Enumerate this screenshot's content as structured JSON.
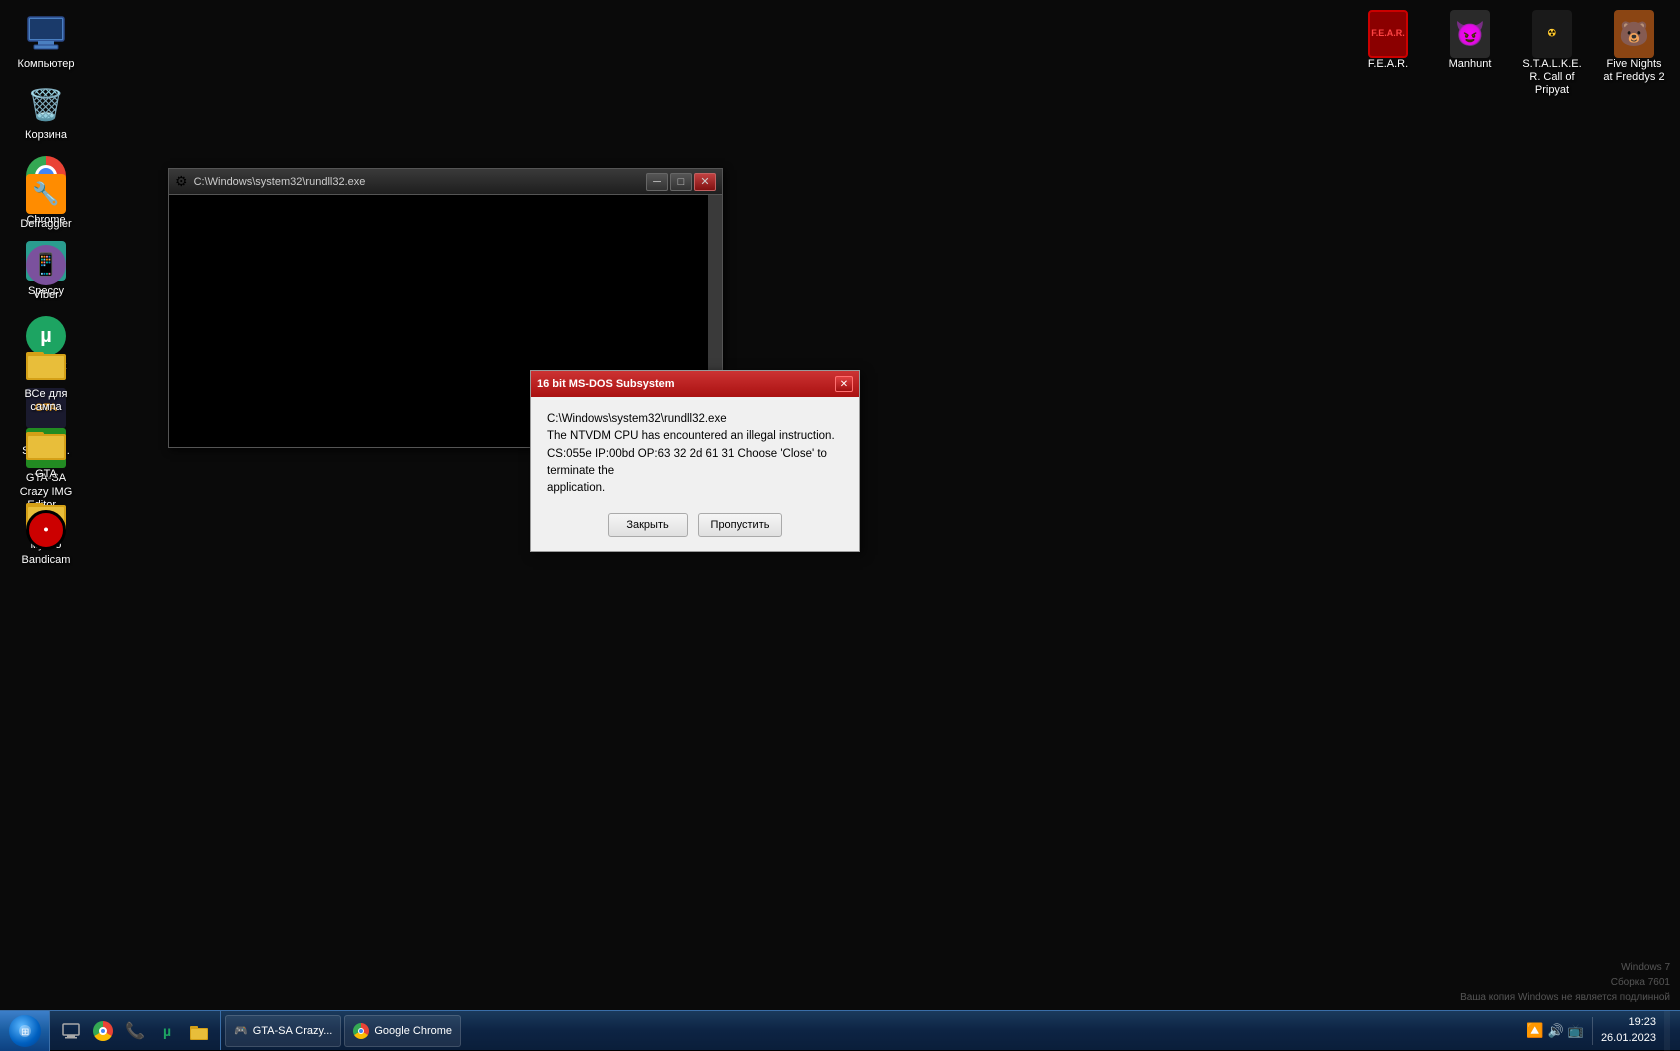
{
  "desktop": {
    "background": "#060606"
  },
  "desktop_icons_left": [
    {
      "id": "computer",
      "label": "Компьютер",
      "icon": "computer"
    },
    {
      "id": "recycle",
      "label": "Корзина",
      "icon": "recycle"
    },
    {
      "id": "chrome",
      "label": "Google Chrome",
      "icon": "chrome"
    },
    {
      "id": "speccy",
      "label": "Speccy",
      "icon": "speccy"
    },
    {
      "id": "defraggler",
      "label": "Defraggler",
      "icon": "defraggler"
    },
    {
      "id": "viber",
      "label": "Viber",
      "icon": "viber"
    },
    {
      "id": "utorrent",
      "label": "µTorrent",
      "icon": "utorrent"
    },
    {
      "id": "gta-sa-cra",
      "label": "GTA-SA_Cra...",
      "icon": "gta"
    },
    {
      "id": "vsesampa",
      "label": "ВСе для сампа",
      "icon": "folder"
    },
    {
      "id": "imgedad",
      "label": "GTA-SA Crazy IMG Editor...",
      "icon": "imged"
    },
    {
      "id": "gta",
      "label": "GTA",
      "icon": "folder"
    },
    {
      "id": "muzlo",
      "label": "музло",
      "icon": "folder"
    },
    {
      "id": "bandicam",
      "label": "Bandicam",
      "icon": "bandicam"
    }
  ],
  "desktop_icons_right": [
    {
      "id": "fear",
      "label": "F.E.A.R.",
      "icon": "fear"
    },
    {
      "id": "manhunt",
      "label": "Manhunt",
      "icon": "manhunt"
    },
    {
      "id": "stalker",
      "label": "S.T.A.L.K.E.R. Call of Pripyat",
      "icon": "stalker"
    },
    {
      "id": "fnaf",
      "label": "Five Nights at Freddys 2",
      "icon": "fnaf"
    }
  ],
  "rundll_window": {
    "title": "C:\\Windows\\system32\\rundll32.exe",
    "icon": "⚙"
  },
  "error_dialog": {
    "title": "16 bit MS-DOS Subsystem",
    "message_line1": "C:\\Windows\\system32\\rundll32.exe",
    "message_line2": "The NTVDM CPU has encountered an illegal instruction.",
    "message_line3": "CS:055e IP:00bd OP:63 32 2d 61 31  Choose 'Close' to terminate the",
    "message_line4": "application.",
    "btn_close": "Закрыть",
    "btn_skip": "Пропустить"
  },
  "taskbar": {
    "start_label": "",
    "time": "19:23",
    "date": "26.01.2023",
    "apps": [
      {
        "label": "GTA-SA Crazy...",
        "icon": "🎮"
      }
    ]
  },
  "tray_icons": [
    "🔼",
    "🔊",
    "📺"
  ],
  "activation_text": {
    "line1": "Windows 7",
    "line2": "Сборка 7601",
    "line3": "Ваша копия Windows не является подлинной"
  }
}
